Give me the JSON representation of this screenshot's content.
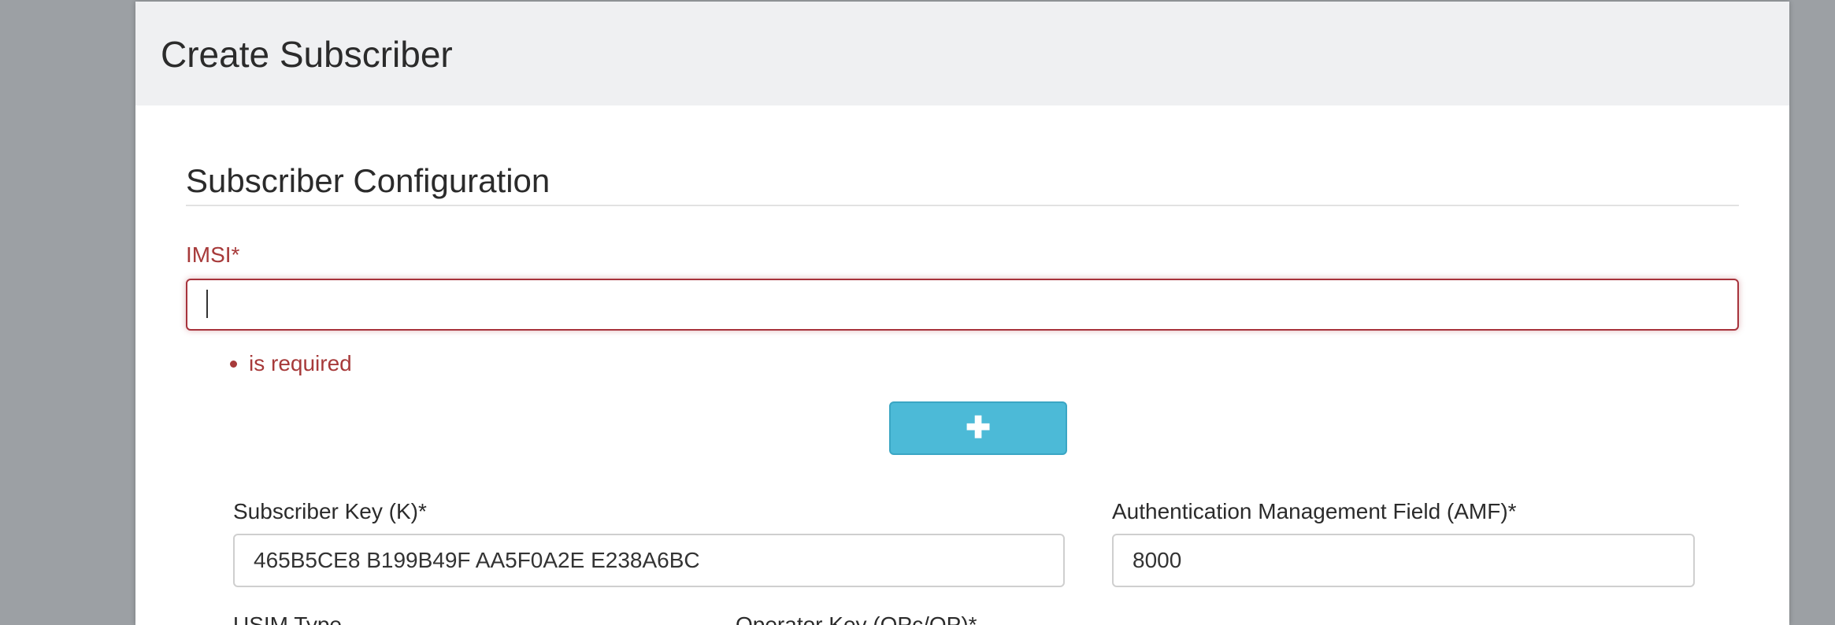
{
  "modal": {
    "title": "Create Subscriber"
  },
  "section": {
    "title": "Subscriber Configuration"
  },
  "imsi": {
    "label": "IMSI*",
    "value": "",
    "errors": [
      "is required"
    ]
  },
  "add_button": {
    "icon": "plus-icon",
    "label": "✚"
  },
  "fields": {
    "subscriber_key": {
      "label": "Subscriber Key (K)*",
      "value": "465B5CE8 B199B49F AA5F0A2E E238A6BC"
    },
    "amf": {
      "label": "Authentication Management Field (AMF)*",
      "value": "8000"
    },
    "usim_type": {
      "label": "USIM Type"
    },
    "operator_key": {
      "label": "Operator Key (OPc/OP)*"
    }
  },
  "colors": {
    "error": "#a73a3a",
    "accent": "#4cbad7",
    "header_bg": "#eff0f2",
    "backdrop": "#9ca0a4"
  }
}
